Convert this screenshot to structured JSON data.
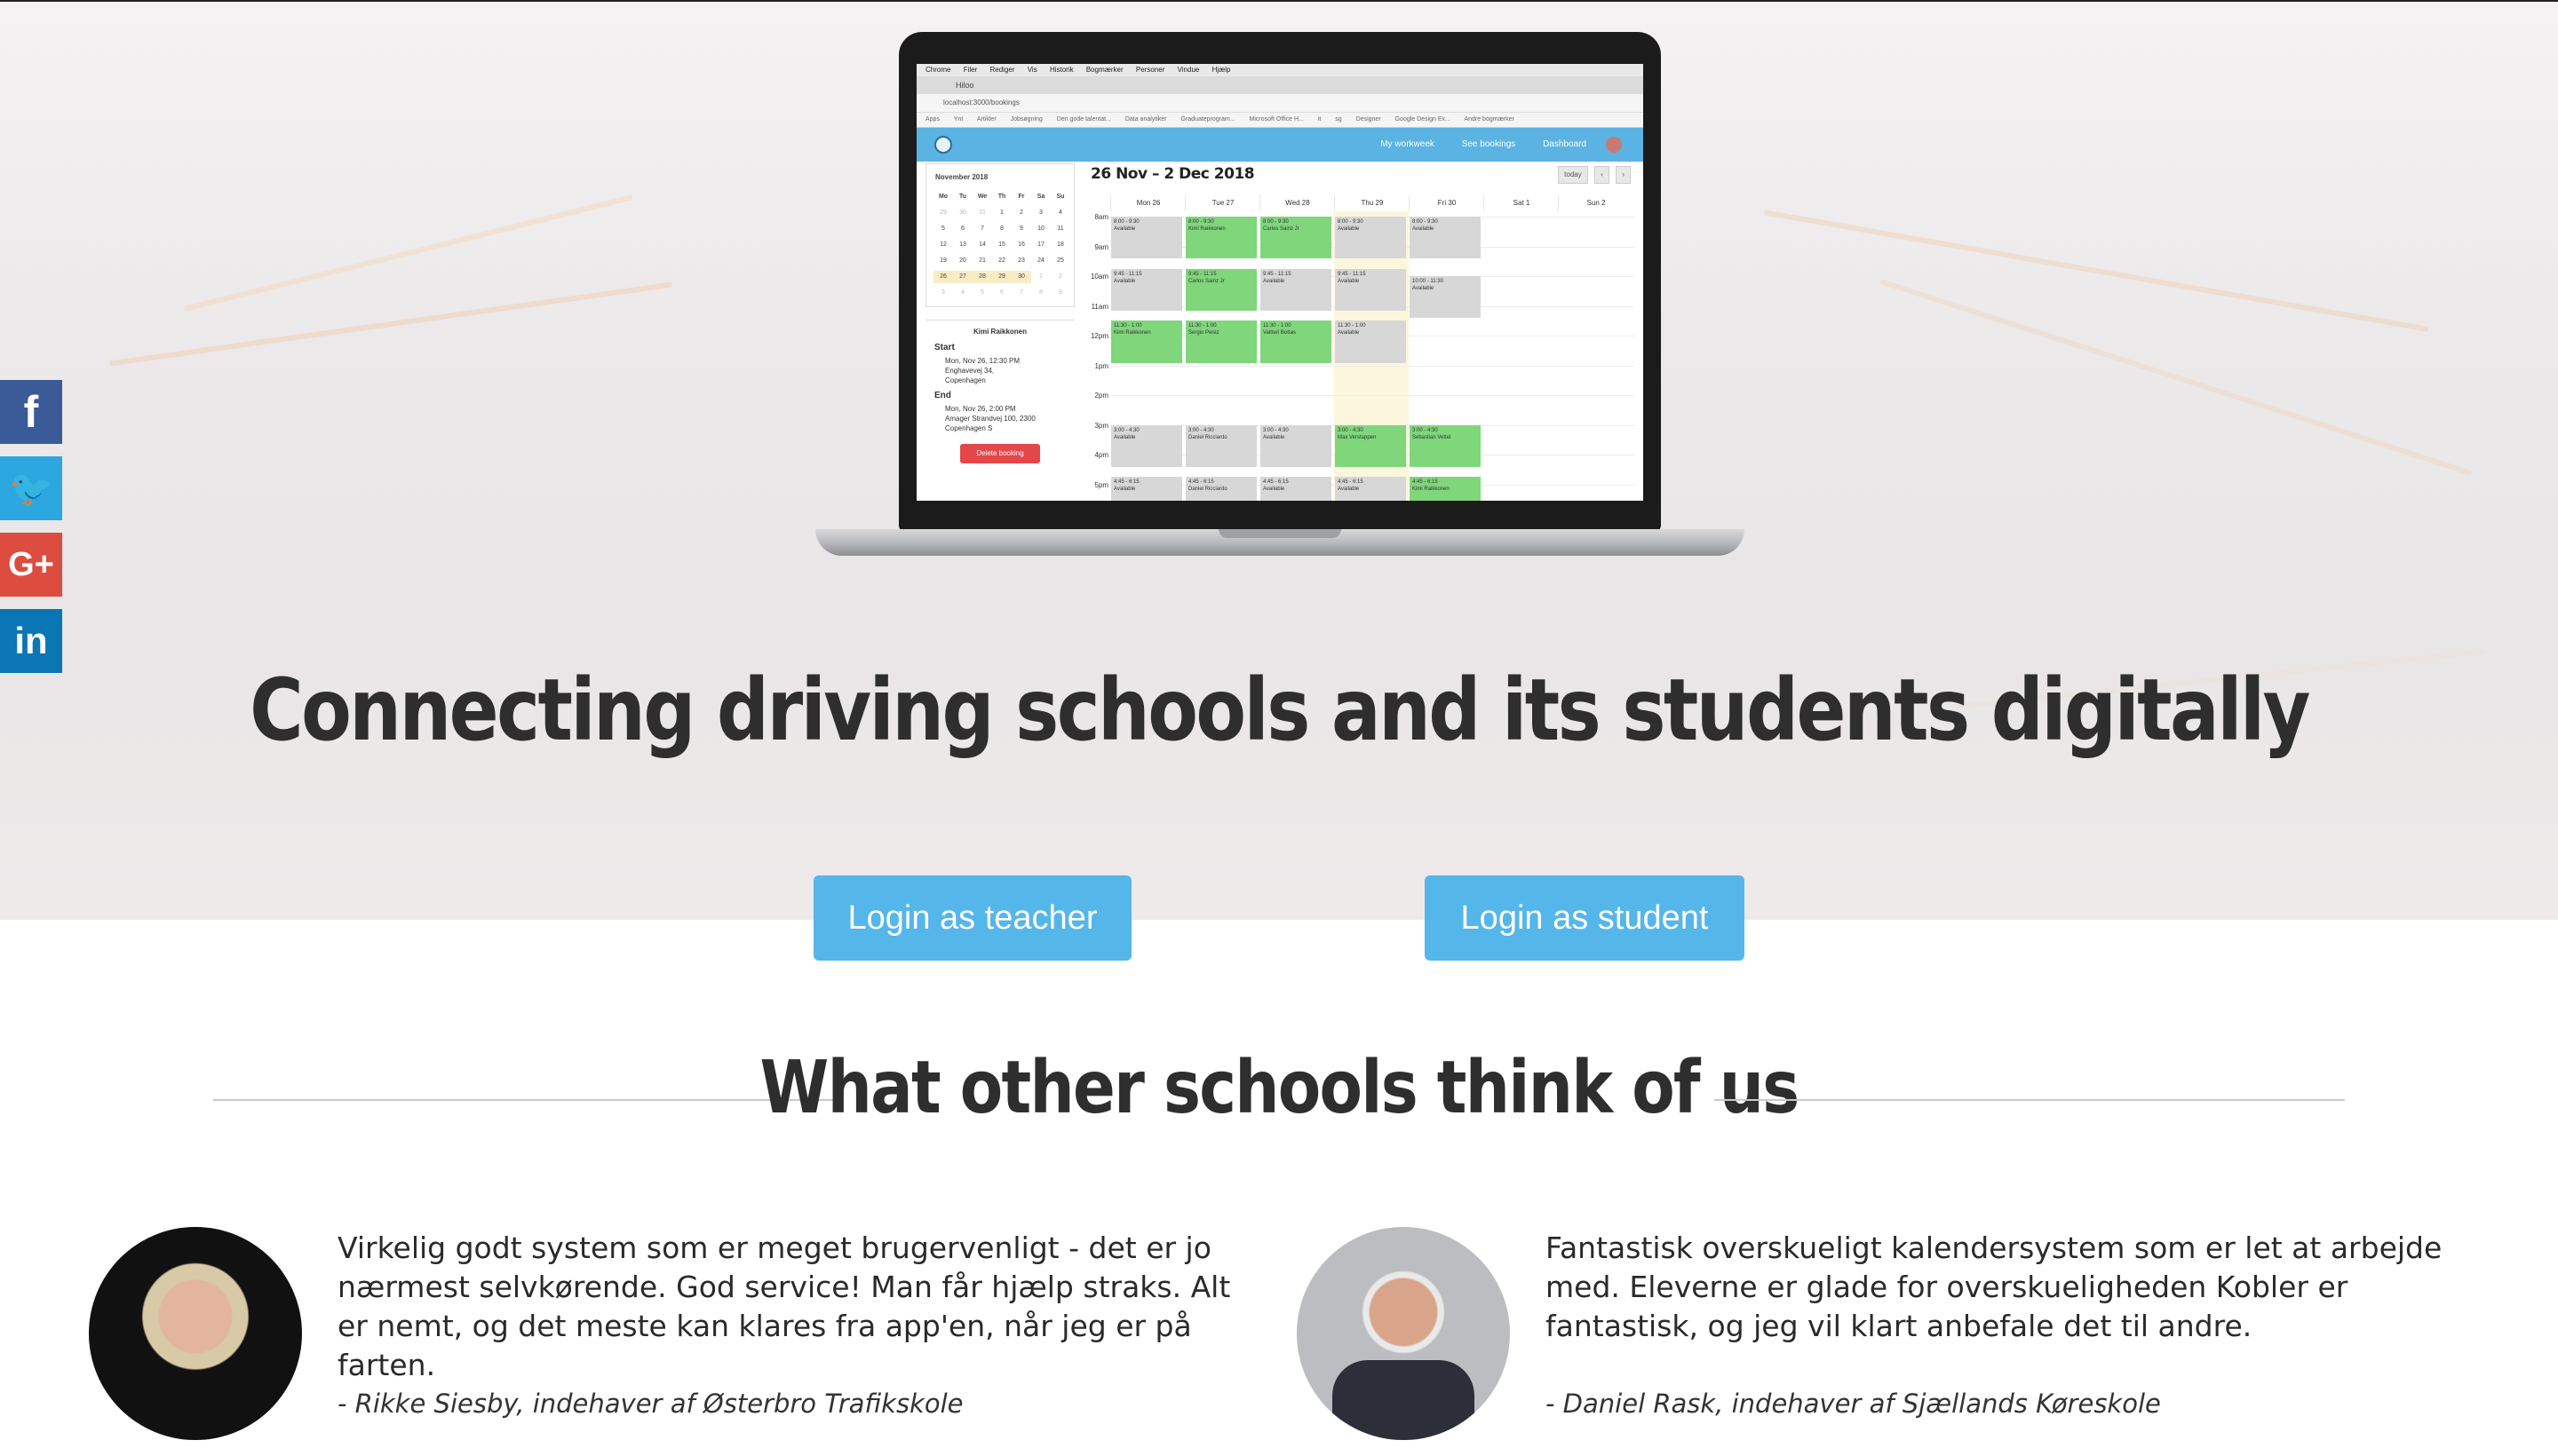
{
  "hero": {
    "headline": "Connecting driving schools and its students digitally",
    "cta_teacher": "Login as teacher",
    "cta_student": "Login as student"
  },
  "social": {
    "facebook_icon": "f",
    "twitter_icon": "🐦",
    "googleplus_icon": "G+",
    "linkedin_icon": "in"
  },
  "laptop_screen": {
    "os_menu": [
      "Chrome",
      "Filer",
      "Rediger",
      "Vis",
      "Historik",
      "Bogmærker",
      "Personer",
      "Vindue",
      "Hjælp"
    ],
    "tab_title": "Hiloo",
    "url": "localhost:3000/bookings",
    "bookmarks": [
      "Apps",
      "Ynt",
      "Artikler",
      "Jobsøgning",
      "Den gode talentat...",
      "Data analytiker",
      "Graduateprogram...",
      "Microsoft Office H...",
      "it",
      "sg",
      "Designer",
      "Google Design Ex...",
      "Andre bogmærker"
    ],
    "nav": [
      "My workweek",
      "See bookings",
      "Dashboard"
    ],
    "mini_calendar": {
      "title": "November 2018",
      "weekdays": [
        "Mo",
        "Tu",
        "We",
        "Th",
        "Fr",
        "Sa",
        "Su"
      ],
      "days": [
        [
          "29",
          "30",
          "31",
          "1",
          "2",
          "3",
          "4"
        ],
        [
          "5",
          "6",
          "7",
          "8",
          "9",
          "10",
          "11"
        ],
        [
          "12",
          "13",
          "14",
          "15",
          "16",
          "17",
          "18"
        ],
        [
          "19",
          "20",
          "21",
          "22",
          "23",
          "24",
          "25"
        ],
        [
          "26",
          "27",
          "28",
          "29",
          "30",
          "1",
          "2"
        ],
        [
          "3",
          "4",
          "5",
          "6",
          "7",
          "8",
          "9"
        ]
      ]
    },
    "booking_detail": {
      "name": "Kimi Raikkonen",
      "start_label": "Start",
      "start_time": "Mon, Nov 26, 12:30 PM",
      "start_place": "Enghavevej 34,",
      "start_city": "Copenhagen",
      "end_label": "End",
      "end_time": "Mon, Nov 26, 2:00 PM",
      "end_place": "Amager Strandvej 100, 2300",
      "end_city": "Copenhagen S",
      "delete_button": "Delete booking"
    },
    "calendar": {
      "title": "26 Nov – 2 Dec 2018",
      "today_button": "today",
      "prev_button": "‹",
      "next_button": "›",
      "days": [
        "Mon 26",
        "Tue 27",
        "Wed 28",
        "Thu 29",
        "Fri 30",
        "Sat 1",
        "Sun 2"
      ],
      "hours": [
        "8am",
        "9am",
        "10am",
        "11am",
        "12pm",
        "1pm",
        "2pm",
        "3pm",
        "4pm",
        "5pm"
      ],
      "events": [
        {
          "day": 0,
          "start": 8.0,
          "end": 9.5,
          "time": "8:00 - 9:30",
          "label": "Available",
          "color": "gray"
        },
        {
          "day": 1,
          "start": 8.0,
          "end": 9.5,
          "time": "8:00 - 9:30",
          "label": "Kimi Raikkonen",
          "color": "green"
        },
        {
          "day": 2,
          "start": 8.0,
          "end": 9.5,
          "time": "8:00 - 9:30",
          "label": "Carlos Sainz Jr",
          "color": "green"
        },
        {
          "day": 3,
          "start": 8.0,
          "end": 9.5,
          "time": "8:00 - 9:30",
          "label": "Available",
          "color": "gray"
        },
        {
          "day": 4,
          "start": 8.0,
          "end": 9.5,
          "time": "8:00 - 9:30",
          "label": "Available",
          "color": "gray"
        },
        {
          "day": 0,
          "start": 9.75,
          "end": 11.25,
          "time": "9:45 - 11:15",
          "label": "Available",
          "color": "gray"
        },
        {
          "day": 1,
          "start": 9.75,
          "end": 11.25,
          "time": "9:45 - 11:15",
          "label": "Carlos Sainz Jr",
          "color": "green"
        },
        {
          "day": 2,
          "start": 9.75,
          "end": 11.25,
          "time": "9:45 - 11:15",
          "label": "Available",
          "color": "gray"
        },
        {
          "day": 3,
          "start": 9.75,
          "end": 11.25,
          "time": "9:45 - 11:15",
          "label": "Available",
          "color": "gray"
        },
        {
          "day": 4,
          "start": 10.0,
          "end": 11.5,
          "time": "10:00 - 11:30",
          "label": "Available",
          "color": "gray"
        },
        {
          "day": 0,
          "start": 11.5,
          "end": 13.0,
          "time": "11:30 - 1:00",
          "label": "Kimi Raikkonen",
          "color": "green"
        },
        {
          "day": 1,
          "start": 11.5,
          "end": 13.0,
          "time": "11:30 - 1:00",
          "label": "Sergio Perez",
          "color": "green"
        },
        {
          "day": 2,
          "start": 11.5,
          "end": 13.0,
          "time": "11:30 - 1:00",
          "label": "Valtteri Bottas",
          "color": "green"
        },
        {
          "day": 3,
          "start": 11.5,
          "end": 13.0,
          "time": "11:30 - 1:00",
          "label": "Available",
          "color": "gray"
        },
        {
          "day": 0,
          "start": 15.0,
          "end": 16.5,
          "time": "3:00 - 4:30",
          "label": "Available",
          "color": "gray"
        },
        {
          "day": 1,
          "start": 15.0,
          "end": 16.5,
          "time": "3:00 - 4:30",
          "label": "Daniel Ricciardo",
          "color": "gray"
        },
        {
          "day": 2,
          "start": 15.0,
          "end": 16.5,
          "time": "3:00 - 4:30",
          "label": "Available",
          "color": "gray"
        },
        {
          "day": 3,
          "start": 15.0,
          "end": 16.5,
          "time": "3:00 - 4:30",
          "label": "Max Verstappen",
          "color": "green"
        },
        {
          "day": 4,
          "start": 15.0,
          "end": 16.5,
          "time": "3:00 - 4:30",
          "label": "Sebastian Vettel",
          "color": "green"
        },
        {
          "day": 0,
          "start": 16.75,
          "end": 18.25,
          "time": "4:45 - 6:15",
          "label": "Available",
          "color": "gray"
        },
        {
          "day": 1,
          "start": 16.75,
          "end": 18.25,
          "time": "4:45 - 6:15",
          "label": "Daniel Ricciardo",
          "color": "gray"
        },
        {
          "day": 2,
          "start": 16.75,
          "end": 18.25,
          "time": "4:45 - 6:15",
          "label": "Available",
          "color": "gray"
        },
        {
          "day": 3,
          "start": 16.75,
          "end": 18.25,
          "time": "4:45 - 6:15",
          "label": "Available",
          "color": "gray"
        },
        {
          "day": 4,
          "start": 16.75,
          "end": 18.25,
          "time": "4:45 - 6:15",
          "label": "Kimi Raikkonen",
          "color": "green"
        }
      ]
    }
  },
  "testimonials": {
    "title": "What other schools think of us",
    "items": [
      {
        "quote": "Virkelig godt system som er meget brugervenligt - det er jo nærmest selvkørende. God service! Man får hjælp straks. Alt er nemt, og det meste kan klares fra app'en, når jeg er på farten.",
        "author": "- Rikke Siesby, indehaver af Østerbro Trafikskole"
      },
      {
        "quote": "Fantastisk overskueligt kalendersystem som er let at arbejde med. Eleverne er glade for overskueligheden Kobler er fantastisk, og jeg vil klart anbefale det til andre.",
        "author": "- Daniel Rask, indehaver af Sjællands Køreskole"
      }
    ]
  },
  "colors": {
    "accent": "#55b6ea",
    "facebook": "#3b5a98",
    "twitter": "#2da7df",
    "googleplus": "#dc4c3f",
    "linkedin": "#0a76b4",
    "event_green": "#7fd67b",
    "event_gray": "#d7d7d7",
    "delete_red": "#e4474a"
  }
}
